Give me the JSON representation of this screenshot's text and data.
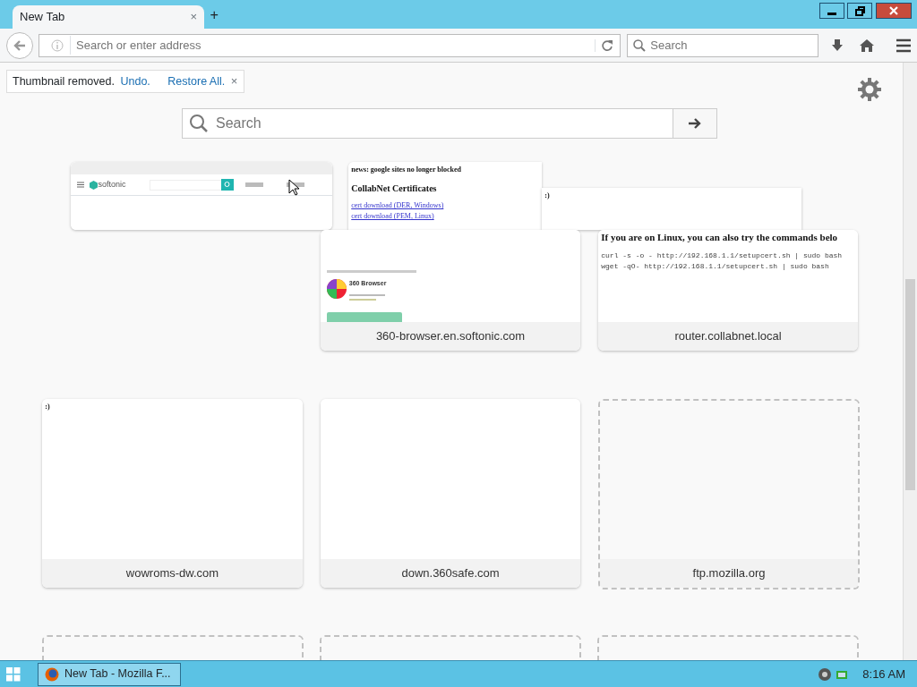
{
  "tabs": [
    {
      "label": "New Tab",
      "selected": true,
      "close": "×"
    }
  ],
  "new_tab_button": "+",
  "toolbar": {
    "address_placeholder": "Search or enter address",
    "search_placeholder": "Search"
  },
  "notification": {
    "text": "Thumbnail removed.",
    "undo": "Undo.",
    "restore_all": "Restore All.",
    "close": "×"
  },
  "page_search": {
    "placeholder": "Search"
  },
  "tiles": [
    {
      "kind": "floating",
      "thumbnail": {
        "kind": "softonic",
        "logo": "softonic"
      }
    },
    {
      "kind": "floating",
      "thumbnail": {
        "kind": "collabnet",
        "headline": "news: google sites no longer blocked",
        "heading": "CollabNet Certificates",
        "links": [
          "cert download (DER, Windows)",
          "cert download (PEM, Linux)"
        ]
      }
    },
    {
      "kind": "floating",
      "thumbnail": {
        "kind": "note",
        "text": ":)"
      }
    },
    {
      "kind": "site",
      "title": "360-browser.en.softonic.com",
      "thumbnail": {
        "kind": "browser360",
        "heading": "360 Browser"
      }
    },
    {
      "kind": "site",
      "title": "router.collabnet.local",
      "thumbnail": {
        "kind": "linux",
        "heading": "If you are on Linux, you can also try the commands belo",
        "lines": [
          "curl -s -o - http://192.168.1.1/setupcert.sh | sudo bash",
          "wget -qO- http://192.168.1.1/setupcert.sh | sudo bash"
        ]
      }
    },
    {
      "kind": "site",
      "title": "wowroms-dw.com",
      "thumbnail": {
        "kind": "note",
        "text": ":)"
      }
    },
    {
      "kind": "site",
      "title": "down.360safe.com",
      "thumbnail": {
        "kind": "blank"
      }
    },
    {
      "kind": "empty",
      "title": "ftp.mozilla.org"
    },
    {
      "kind": "empty"
    },
    {
      "kind": "empty"
    },
    {
      "kind": "empty"
    }
  ],
  "taskbar": {
    "window_button": "New Tab - Mozilla F...",
    "clock": "8:16 AM"
  }
}
